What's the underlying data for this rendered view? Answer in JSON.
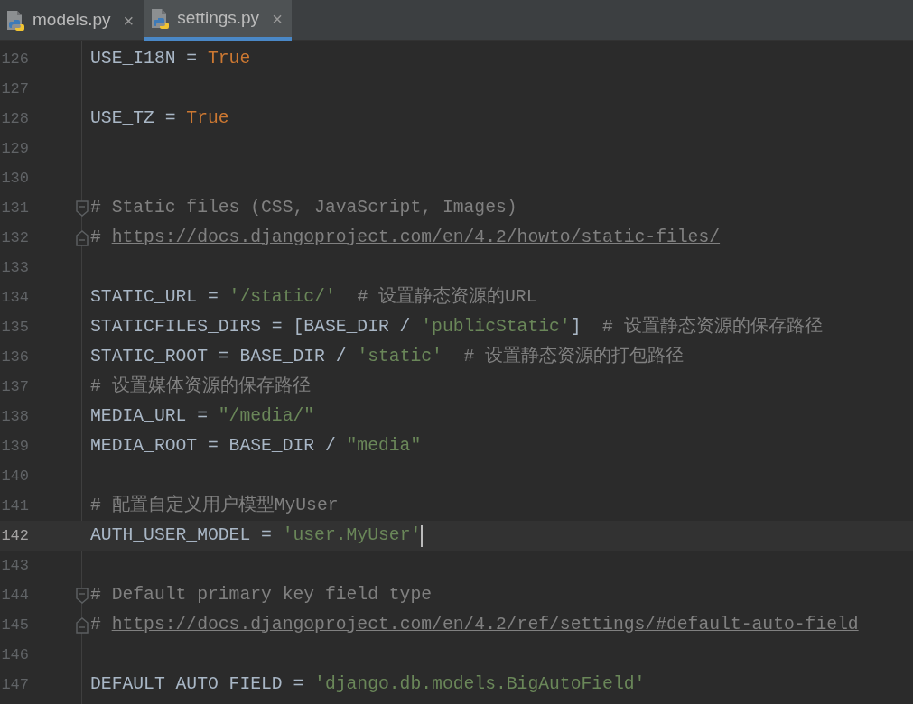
{
  "tabs": [
    {
      "label": "models.py",
      "selected": false,
      "close": "×"
    },
    {
      "label": "settings.py",
      "selected": true,
      "close": "×"
    }
  ],
  "editor": {
    "lines": [
      {
        "number": "126",
        "kind": "plain",
        "selected": false,
        "tokens": [
          {
            "kind": "plain",
            "text": "USE_I18N = "
          },
          {
            "kind": "keyword",
            "text": "True"
          }
        ]
      },
      {
        "number": "127",
        "kind": "plain",
        "selected": false
      },
      {
        "number": "128",
        "kind": "plain",
        "selected": false,
        "tokens": [
          {
            "kind": "plain",
            "text": "USE_TZ = "
          },
          {
            "kind": "keyword",
            "text": "True"
          }
        ]
      },
      {
        "number": "129",
        "kind": "plain",
        "selected": false
      },
      {
        "number": "130",
        "kind": "plain",
        "selected": false
      },
      {
        "number": "131",
        "kind": "foldstart",
        "selected": false,
        "tokens": [
          {
            "kind": "comment",
            "text": "# Static files (CSS, JavaScript, Images)"
          }
        ]
      },
      {
        "number": "132",
        "kind": "foldend",
        "selected": false,
        "tokens": [
          {
            "kind": "comment",
            "text": "# "
          },
          {
            "kind": "link",
            "text": "https://docs.djangoproject.com/en/4.2/howto/static-files/"
          }
        ]
      },
      {
        "number": "133",
        "kind": "plain",
        "selected": false
      },
      {
        "number": "134",
        "kind": "plain",
        "selected": false,
        "tokens": [
          {
            "kind": "plain",
            "text": "STATIC_URL = "
          },
          {
            "kind": "string",
            "text": "'/static/'"
          },
          {
            "kind": "comment",
            "text": "  # 设置静态资源的URL"
          }
        ]
      },
      {
        "number": "135",
        "kind": "plain",
        "selected": false,
        "tokens": [
          {
            "kind": "plain",
            "text": "STATICFILES_DIRS = [BASE_DIR / "
          },
          {
            "kind": "string",
            "text": "'publicStatic'"
          },
          {
            "kind": "plain",
            "text": "]"
          },
          {
            "kind": "comment",
            "text": "  # 设置静态资源的保存路径"
          }
        ]
      },
      {
        "number": "136",
        "kind": "plain",
        "selected": false,
        "tokens": [
          {
            "kind": "plain",
            "text": "STATIC_ROOT = BASE_DIR / "
          },
          {
            "kind": "string",
            "text": "'static'"
          },
          {
            "kind": "comment",
            "text": "  # 设置静态资源的打包路径"
          }
        ]
      },
      {
        "number": "137",
        "kind": "plain",
        "selected": false,
        "tokens": [
          {
            "kind": "comment",
            "text": "# 设置媒体资源的保存路径"
          }
        ]
      },
      {
        "number": "138",
        "kind": "plain",
        "selected": false,
        "tokens": [
          {
            "kind": "plain",
            "text": "MEDIA_URL = "
          },
          {
            "kind": "string",
            "text": "\"/media/\""
          }
        ]
      },
      {
        "number": "139",
        "kind": "plain",
        "selected": false,
        "tokens": [
          {
            "kind": "plain",
            "text": "MEDIA_ROOT = BASE_DIR / "
          },
          {
            "kind": "string",
            "text": "\"media\""
          }
        ]
      },
      {
        "number": "140",
        "kind": "plain",
        "selected": false
      },
      {
        "number": "141",
        "kind": "plain",
        "selected": false,
        "tokens": [
          {
            "kind": "comment",
            "text": "# 配置自定义用户模型MyUser"
          }
        ]
      },
      {
        "number": "142",
        "kind": "plain",
        "selected": true,
        "tokens": [
          {
            "kind": "plain",
            "text": "AUTH_USER_MODEL = "
          },
          {
            "kind": "string",
            "text": "'user.MyUser'"
          }
        ]
      },
      {
        "number": "143",
        "kind": "plain",
        "selected": false
      },
      {
        "number": "144",
        "kind": "foldstart",
        "selected": false,
        "tokens": [
          {
            "kind": "comment",
            "text": "# Default primary key field type"
          }
        ]
      },
      {
        "number": "145",
        "kind": "foldend",
        "selected": false,
        "tokens": [
          {
            "kind": "comment",
            "text": "# "
          },
          {
            "kind": "link",
            "text": "https://docs.djangoproject.com/en/4.2/ref/settings/#default-auto-field"
          }
        ]
      },
      {
        "number": "146",
        "kind": "plain",
        "selected": false
      },
      {
        "number": "147",
        "kind": "plain",
        "selected": false,
        "tokens": [
          {
            "kind": "plain",
            "text": "DEFAULT_AUTO_FIELD = "
          },
          {
            "kind": "string",
            "text": "'django.db.models.BigAutoField'"
          }
        ]
      }
    ]
  }
}
